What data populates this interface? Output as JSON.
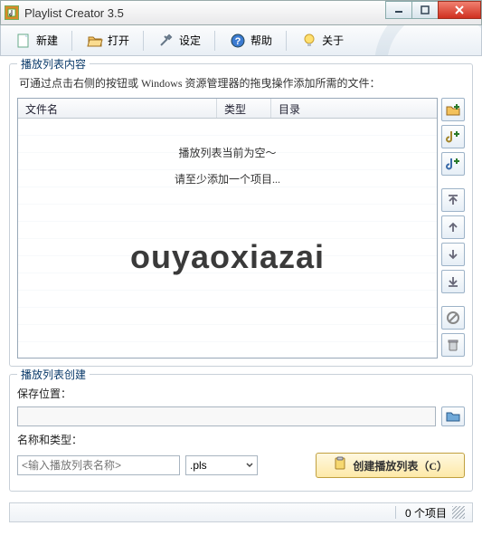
{
  "window": {
    "title": "Playlist Creator 3.5"
  },
  "toolbar": {
    "new": "新建",
    "open": "打开",
    "settings": "设定",
    "help": "帮助",
    "about": "关于"
  },
  "content_group": {
    "title": "播放列表内容",
    "hint": "可通过点击右侧的按钮或 Windows 资源管理器的拖曳操作添加所需的文件：",
    "columns": {
      "filename": "文件名",
      "type": "类型",
      "dir": "目录"
    },
    "empty_line1": "播放列表当前为空～",
    "empty_line2": "请至少添加一个项目...",
    "watermark": "ouyaoxiazai"
  },
  "create_group": {
    "title": "播放列表创建",
    "save_location_label": "保存位置：",
    "save_location_value": "",
    "name_type_label": "名称和类型：",
    "name_placeholder": "<输入播放列表名称>",
    "format_selected": ".pls",
    "create_button": "创建播放列表（C）"
  },
  "status": {
    "items": "0 个项目"
  }
}
